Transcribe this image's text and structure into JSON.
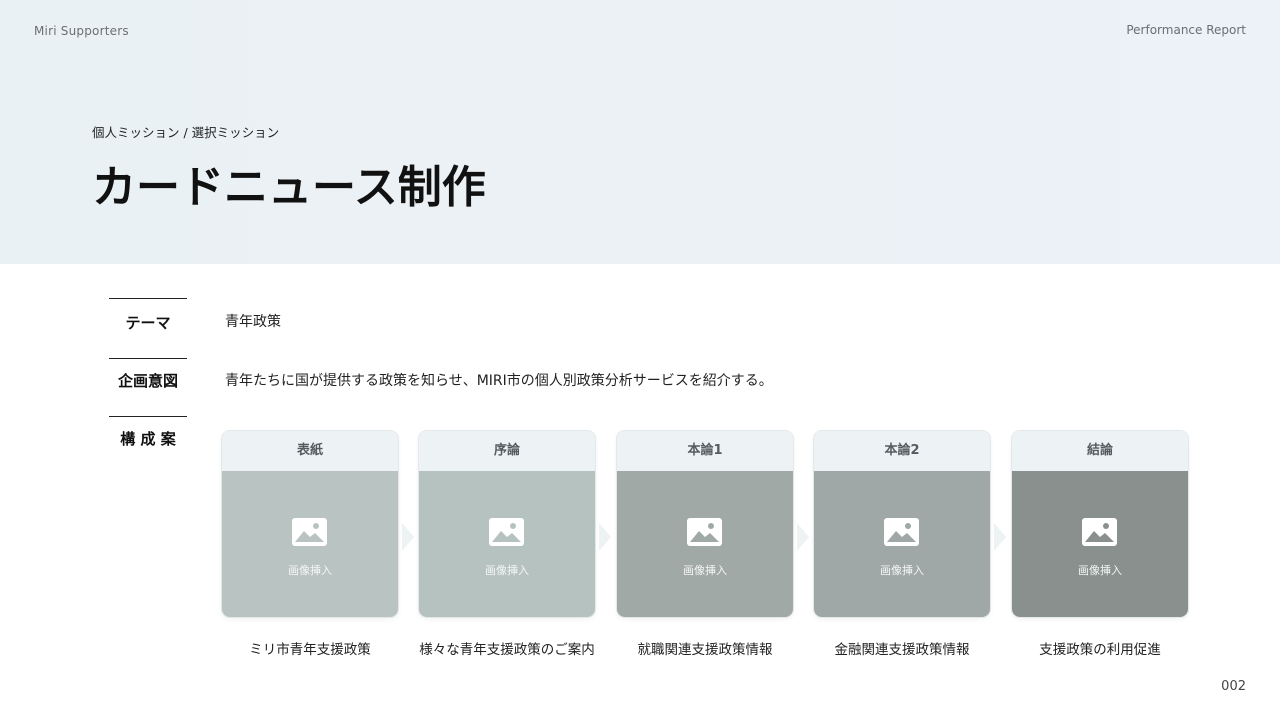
{
  "header": {
    "brand": "Miri Supporters",
    "report": "Performance Report"
  },
  "hero": {
    "subtitle": "個人ミッション / 選択ミッション",
    "title": "カードニュース制作"
  },
  "rows": [
    {
      "label": "テーマ",
      "value": "青年政策"
    },
    {
      "label": "企画意図",
      "value": "青年たちに国が提供する政策を知らせ、MIRI市の個人別政策分析サービスを紹介する。"
    },
    {
      "label": "構 成 案",
      "value": ""
    }
  ],
  "cards": [
    {
      "header": "表紙",
      "image_label": "画像挿入",
      "caption": "ミリ市青年支援政策",
      "color": "#b9c3c1"
    },
    {
      "header": "序論",
      "image_label": "画像挿入",
      "caption": "様々な青年支援政策のご案内",
      "color": "#b6c2c0"
    },
    {
      "header": "本論1",
      "image_label": "画像挿入",
      "caption": "就職関連支援政策情報",
      "color": "#a1a9a7"
    },
    {
      "header": "本論2",
      "image_label": "画像挿入",
      "caption": "金融関連支援政策情報",
      "color": "#9fa8a6"
    },
    {
      "header": "結論",
      "image_label": "画像挿入",
      "caption": "支援政策の利用促進",
      "color": "#8a908e"
    }
  ],
  "icons": {
    "image": "image-placeholder-icon",
    "arrow": "chevron-right-icon"
  },
  "footer": {
    "page_number": "002"
  }
}
